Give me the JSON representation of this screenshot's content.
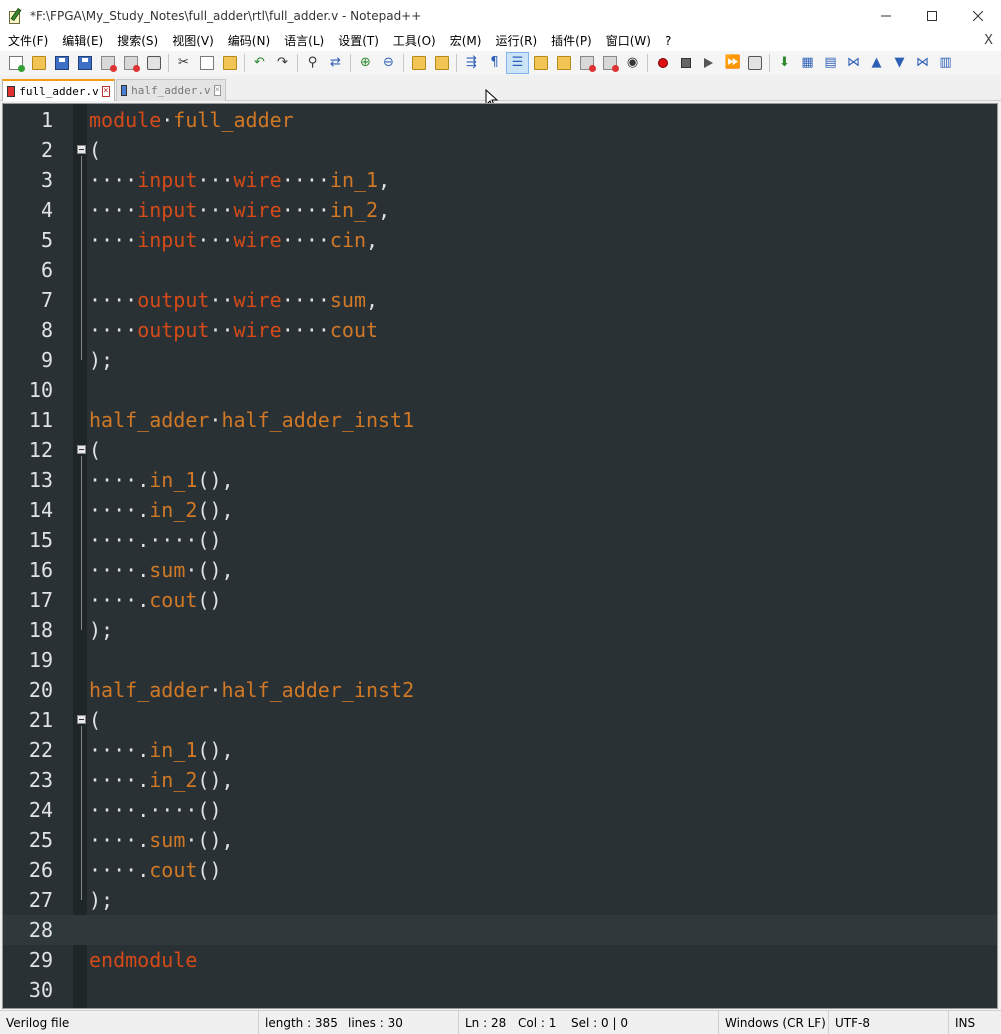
{
  "window": {
    "title": "*F:\\FPGA\\My_Study_Notes\\full_adder\\rtl\\full_adder.v - Notepad++"
  },
  "menu": {
    "items": [
      "文件(F)",
      "编辑(E)",
      "搜索(S)",
      "视图(V)",
      "编码(N)",
      "语言(L)",
      "设置(T)",
      "工具(O)",
      "宏(M)",
      "运行(R)",
      "插件(P)",
      "窗口(W)",
      "?"
    ],
    "close_glyph": "X"
  },
  "tabs": [
    {
      "label": "full_adder.v",
      "active": true
    },
    {
      "label": "half_adder.v",
      "active": false
    }
  ],
  "editor": {
    "current_line": 28,
    "lines": [
      {
        "n": "1",
        "text": "module·full_adder",
        "fold": false
      },
      {
        "n": "2",
        "text": "(",
        "fold": true
      },
      {
        "n": "3",
        "text": "····input···wire····in_1,",
        "fold": false
      },
      {
        "n": "4",
        "text": "····input···wire····in_2,",
        "fold": false
      },
      {
        "n": "5",
        "text": "····input···wire····cin,",
        "fold": false
      },
      {
        "n": "6",
        "text": "",
        "fold": false
      },
      {
        "n": "7",
        "text": "····output··wire····sum,",
        "fold": false
      },
      {
        "n": "8",
        "text": "····output··wire····cout",
        "fold": false
      },
      {
        "n": "9",
        "text": ");",
        "fold": false
      },
      {
        "n": "10",
        "text": "",
        "fold": false
      },
      {
        "n": "11",
        "text": "half_adder·half_adder_inst1",
        "fold": false
      },
      {
        "n": "12",
        "text": "(",
        "fold": true
      },
      {
        "n": "13",
        "text": "····.in_1(),",
        "fold": false
      },
      {
        "n": "14",
        "text": "····.in_2(),",
        "fold": false
      },
      {
        "n": "15",
        "text": "····.····()",
        "fold": false
      },
      {
        "n": "16",
        "text": "····.sum·(),",
        "fold": false
      },
      {
        "n": "17",
        "text": "····.cout()",
        "fold": false
      },
      {
        "n": "18",
        "text": ");",
        "fold": false
      },
      {
        "n": "19",
        "text": "",
        "fold": false
      },
      {
        "n": "20",
        "text": "half_adder·half_adder_inst2",
        "fold": false
      },
      {
        "n": "21",
        "text": "(",
        "fold": true
      },
      {
        "n": "22",
        "text": "····.in_1(),",
        "fold": false
      },
      {
        "n": "23",
        "text": "····.in_2(),",
        "fold": false
      },
      {
        "n": "24",
        "text": "····.····()",
        "fold": false
      },
      {
        "n": "25",
        "text": "····.sum·(),",
        "fold": false
      },
      {
        "n": "26",
        "text": "····.cout()",
        "fold": false
      },
      {
        "n": "27",
        "text": ");",
        "fold": false
      },
      {
        "n": "28",
        "text": "",
        "fold": false
      },
      {
        "n": "29",
        "text": "endmodule",
        "fold": false
      },
      {
        "n": "30",
        "text": "",
        "fold": false
      }
    ]
  },
  "status": {
    "file_type": "Verilog file",
    "length": "length : 385",
    "lines": "lines : 30",
    "ln": "Ln : 28",
    "col": "Col : 1",
    "sel": "Sel : 0 | 0",
    "eol": "Windows (CR LF)",
    "encoding": "UTF-8",
    "mode": "INS"
  },
  "colors": {
    "editor_bg": "#293134",
    "identifier": "#d07826",
    "keyword": "#d44a18",
    "punctuation": "#e0e2e4",
    "line_number": "#e0e2e4",
    "tab_accent": "#f39c11"
  }
}
